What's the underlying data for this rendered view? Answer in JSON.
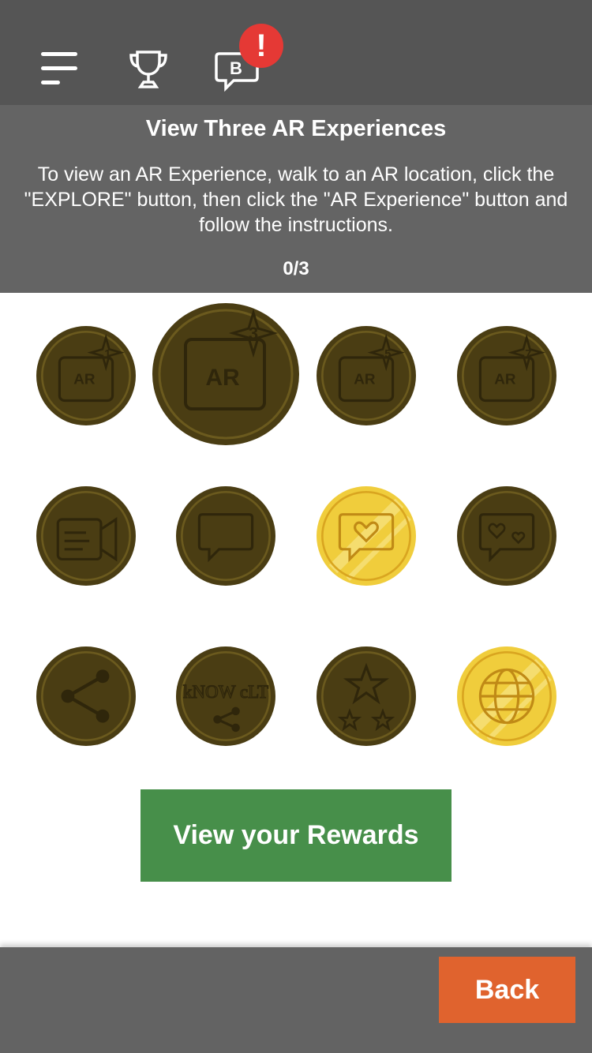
{
  "header": {
    "alert_symbol": "!",
    "badge_letter": "B",
    "icons": [
      "menu-icon",
      "trophy-icon",
      "chat-badge-icon"
    ]
  },
  "challenge": {
    "title": "View Three AR Experiences",
    "description": "To view an AR Experience, walk to an AR location, click the \"EXPLORE\" button, then click the \"AR Experience\" button and follow the instructions.",
    "progress": "0/3"
  },
  "badges": [
    {
      "icon": "ar-1-icon",
      "label": "AR",
      "number": "1",
      "status": "locked",
      "selected": false
    },
    {
      "icon": "ar-3-icon",
      "label": "AR",
      "number": "3",
      "status": "locked",
      "selected": true
    },
    {
      "icon": "ar-5-icon",
      "label": "AR",
      "number": "5",
      "status": "locked",
      "selected": false
    },
    {
      "icon": "ar-7-icon",
      "label": "AR",
      "number": "7",
      "status": "locked",
      "selected": false
    },
    {
      "icon": "video-call-icon",
      "status": "locked"
    },
    {
      "icon": "chat-bubble-icon",
      "status": "locked"
    },
    {
      "icon": "heart-chat-icon",
      "status": "earned"
    },
    {
      "icon": "hearts-chat-icon",
      "status": "locked"
    },
    {
      "icon": "share-icon",
      "status": "locked"
    },
    {
      "icon": "know-clt-share-icon",
      "label": "kNOW cLT",
      "status": "locked"
    },
    {
      "icon": "stars-icon",
      "status": "locked"
    },
    {
      "icon": "globe-icon",
      "status": "earned"
    }
  ],
  "colors": {
    "header_bg": "#555555",
    "challenge_bg": "#646464",
    "locked_coin": "#4a3d13",
    "earned_coin": "#f0cd3c",
    "rewards_button": "#478f4a",
    "back_button": "#e0632e",
    "footer_bg": "#636363",
    "alert_red": "#e53935"
  },
  "actions": {
    "view_rewards_label": "View your Rewards",
    "back_label": "Back"
  }
}
